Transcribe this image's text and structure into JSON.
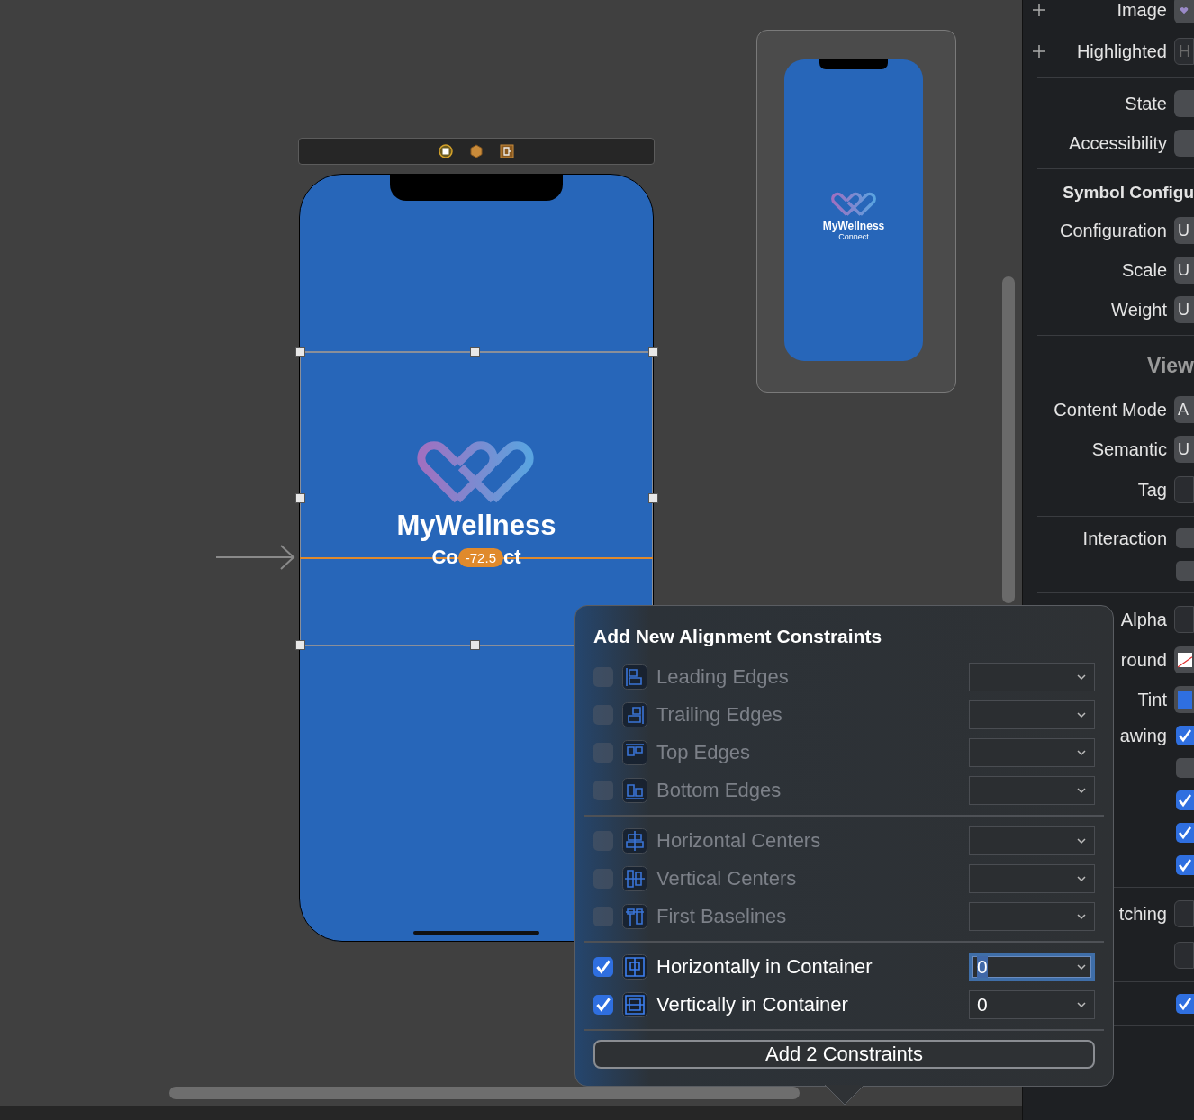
{
  "scene": {
    "title": "MyWellness",
    "subtitle_parts": [
      "Co",
      "ct"
    ],
    "offset_badge": "-72.5"
  },
  "preview": {
    "title": "MyWellness",
    "subtitle": "Connect"
  },
  "inspector": {
    "sections": [
      [
        {
          "kind": "image",
          "label": "Image",
          "addable": true
        },
        {
          "kind": "field",
          "label": "Highlighted",
          "placeholder": "H",
          "addable": true
        }
      ],
      [
        {
          "kind": "popup",
          "label": "State"
        },
        {
          "kind": "popup",
          "label": "Accessibility"
        }
      ],
      [
        {
          "kind": "heading",
          "label": "Symbol Configu"
        },
        {
          "kind": "popup",
          "label": "Configuration",
          "value": "U"
        },
        {
          "kind": "popup",
          "label": "Scale",
          "value": "U"
        },
        {
          "kind": "popup",
          "label": "Weight",
          "value": "U"
        }
      ],
      [
        {
          "kind": "title",
          "label": "View"
        },
        {
          "kind": "popup",
          "label": "Content Mode",
          "value": "A"
        },
        {
          "kind": "popup",
          "label": "Semantic",
          "value": "U"
        },
        {
          "kind": "field",
          "label": "Tag"
        }
      ],
      [
        {
          "kind": "check",
          "label": "Interaction",
          "checked": false
        },
        {
          "kind": "check",
          "checked": false
        }
      ],
      [
        {
          "kind": "field",
          "label": "Alpha"
        },
        {
          "kind": "clear-color",
          "label": "round"
        },
        {
          "kind": "color",
          "label": "Tint",
          "color": "#2f6fe0"
        },
        {
          "kind": "check",
          "label": "awing",
          "checked": true
        },
        {
          "kind": "check",
          "checked": false
        },
        {
          "kind": "check",
          "checked": true
        },
        {
          "kind": "check",
          "checked": true
        },
        {
          "kind": "check",
          "checked": true
        }
      ],
      [
        {
          "kind": "field",
          "label": "tching"
        },
        {
          "kind": "field"
        }
      ],
      [
        {
          "kind": "check",
          "checked": true
        }
      ]
    ]
  },
  "popover": {
    "title": "Add New Alignment Constraints",
    "groups": [
      [
        {
          "kind": "leading",
          "label": "Leading Edges",
          "checked": false,
          "disabled": true,
          "focused": false
        },
        {
          "kind": "trailing",
          "label": "Trailing Edges",
          "checked": false,
          "disabled": true,
          "focused": false
        },
        {
          "kind": "top",
          "label": "Top Edges",
          "checked": false,
          "disabled": true,
          "focused": false
        },
        {
          "kind": "bottom",
          "label": "Bottom Edges",
          "checked": false,
          "disabled": true,
          "focused": false
        }
      ],
      [
        {
          "kind": "hcenter",
          "label": "Horizontal Centers",
          "checked": false,
          "disabled": true,
          "focused": false
        },
        {
          "kind": "vcenter",
          "label": "Vertical Centers",
          "checked": false,
          "disabled": true,
          "focused": false
        },
        {
          "kind": "baseline",
          "label": "First Baselines",
          "checked": false,
          "disabled": true,
          "focused": false
        }
      ],
      [
        {
          "kind": "hcontainer",
          "label": "Horizontally in Container",
          "checked": true,
          "disabled": false,
          "focused": true,
          "value": "0"
        },
        {
          "kind": "vcontainer",
          "label": "Vertically in Container",
          "checked": true,
          "disabled": false,
          "focused": false,
          "value": "0"
        }
      ]
    ],
    "button": "Add 2 Constraints"
  }
}
